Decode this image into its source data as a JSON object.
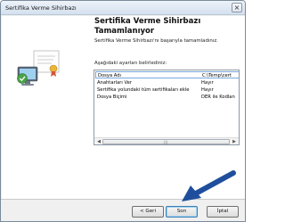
{
  "window": {
    "title": "Sertifika Verme Sihirbazı",
    "close_glyph": "×"
  },
  "main": {
    "heading": "Sertifika Verme Sihirbazı Tamamlanıyor",
    "subtext": "Sertifika Verme Sihirbazı'nı başarıyla tamamladınız.",
    "list_label": "Aşağıdaki ayarları belirlediniz:",
    "settings": [
      {
        "key": "Dosya Adı",
        "value": "C:\\Temp\\cert"
      },
      {
        "key": "Anahtarları Ver",
        "value": "Hayır"
      },
      {
        "key": "Sertifika yolundaki tüm sertifikaları ekle",
        "value": "Hayır"
      },
      {
        "key": "Dosya Biçimi",
        "value": "DER ile Kodlan"
      }
    ]
  },
  "footer": {
    "back_label": "< Geri",
    "finish_label": "Son",
    "cancel_label": "İptal"
  },
  "icons": {
    "wizard_illustration": "certificate-computer-icon",
    "pointer": "blue-arrow-pointer"
  },
  "colors": {
    "pointer_blue": "#1f4f9c",
    "selection_border": "#7aa7d9",
    "default_button_border": "#3c7fb1"
  }
}
